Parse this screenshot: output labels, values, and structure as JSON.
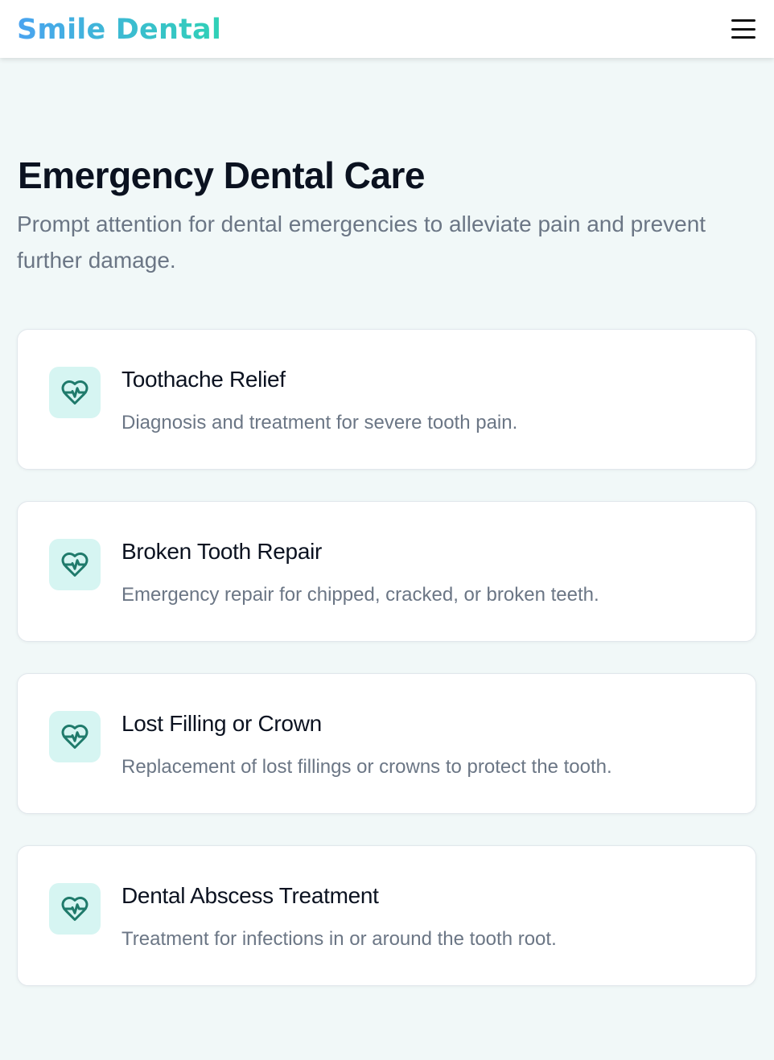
{
  "header": {
    "logo": "Smile Dental",
    "menu_icon": "hamburger-menu-icon"
  },
  "hero": {
    "title": "Emergency Dental Care",
    "subtitle": "Prompt attention for dental emergencies to alleviate pain and prevent further damage."
  },
  "services": [
    {
      "icon": "heart-pulse-icon",
      "title": "Toothache Relief",
      "description": "Diagnosis and treatment for severe tooth pain."
    },
    {
      "icon": "heart-pulse-icon",
      "title": "Broken Tooth Repair",
      "description": "Emergency repair for chipped, cracked, or broken teeth."
    },
    {
      "icon": "heart-pulse-icon",
      "title": "Lost Filling or Crown",
      "description": "Replacement of lost fillings or crowns to protect the tooth."
    },
    {
      "icon": "heart-pulse-icon",
      "title": "Dental Abscess Treatment",
      "description": "Treatment for infections in or around the tooth root."
    }
  ],
  "colors": {
    "brand_gradient_start": "#4aa3f0",
    "brand_gradient_end": "#2fd1b6",
    "icon_bg": "#d6f5f2",
    "icon_stroke": "#1f7a6b",
    "page_bg": "#f1f8f8"
  }
}
